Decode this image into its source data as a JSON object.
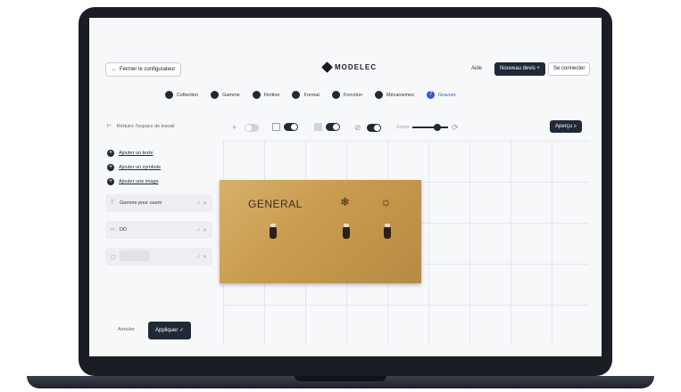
{
  "header": {
    "back_label": "Fermer le configurateur",
    "brand": "MODELEC",
    "help": "Aide",
    "new_quote": "Nouveau devis +",
    "login": "Se connecter"
  },
  "stepper": [
    {
      "label": "Collection"
    },
    {
      "label": "Gamme"
    },
    {
      "label": "Finition"
    },
    {
      "label": "Format"
    },
    {
      "label": "Fonction"
    },
    {
      "label": "Mécanismes"
    },
    {
      "label": "Gravure",
      "index": "7"
    }
  ],
  "toolbar": {
    "hint": "Réduire l'espace de travail",
    "zoom_label": "Zoom",
    "preview": "Aperçu"
  },
  "add_actions": [
    "Ajouter un texte",
    "Ajouter un symbole",
    "Ajouter une image"
  ],
  "layers": [
    {
      "icon": "T",
      "text": "Gamme pour ouvrir"
    },
    {
      "icon": "∞",
      "text": "DD"
    },
    {
      "icon": "▢",
      "text": ""
    }
  ],
  "footer": {
    "cancel": "Annuler",
    "apply": "Appliquer ✓"
  },
  "plate": {
    "label": "GENERAL",
    "icons": [
      "snowflake-icon",
      "sun-icon"
    ],
    "color": "#c99a4e"
  }
}
